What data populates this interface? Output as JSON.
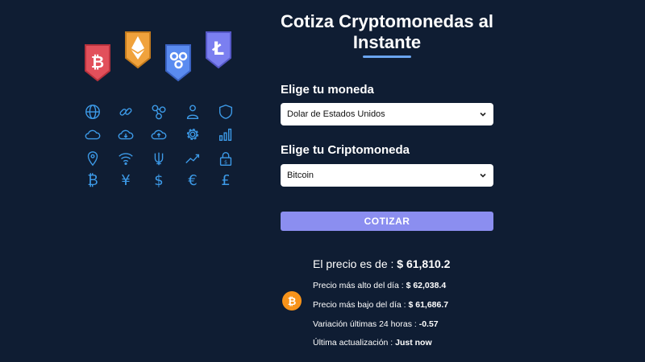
{
  "header": {
    "title_line1": "Cotiza Cryptomonedas al",
    "title_line2": "Instante"
  },
  "form": {
    "currency_label": "Elige tu moneda",
    "currency_selected": "Dolar de Estados Unidos",
    "crypto_label": "Elige tu Criptomoneda",
    "crypto_selected": "Bitcoin",
    "submit_label": "COTIZAR"
  },
  "result": {
    "price_label": "El precio es de :",
    "price_value": "$ 61,810.2",
    "high_label": "Precio más alto del día :",
    "high_value": "$ 62,038.4",
    "low_label": "Precio más bajo del día :",
    "low_value": "$ 61,686.7",
    "change_label": "Variación últimas 24 horas :",
    "change_value": "-0.57",
    "updated_label": "Última actualización :",
    "updated_value": "Just now"
  },
  "illustration": {
    "badges": [
      "bitcoin-badge",
      "ethereum-badge",
      "ripple-badge",
      "litecoin-badge"
    ],
    "icons": [
      "globe-icon",
      "link-icon",
      "molecule-icon",
      "user-icon",
      "shield-icon",
      "cloud-icon",
      "cloud-download-icon",
      "cloud-upload-icon",
      "gear-icon",
      "bar-chart-icon",
      "location-pin-icon",
      "wifi-icon",
      "trident-icon",
      "trend-up-icon",
      "lock-icon",
      "bitcoin-symbol-icon",
      "yen-symbol-icon",
      "dollar-symbol-icon",
      "euro-symbol-icon",
      "pound-symbol-icon"
    ],
    "currency_glyphs": {
      "bitcoin": "₿",
      "yen": "¥",
      "dollar": "$",
      "euro": "€",
      "pound": "£"
    }
  },
  "colors": {
    "background": "#0f1d33",
    "accent_blue": "#3d9be9",
    "button": "#8b8ef0",
    "title_underline": "#6aa5f0",
    "bitcoin_orange": "#f7931a"
  }
}
